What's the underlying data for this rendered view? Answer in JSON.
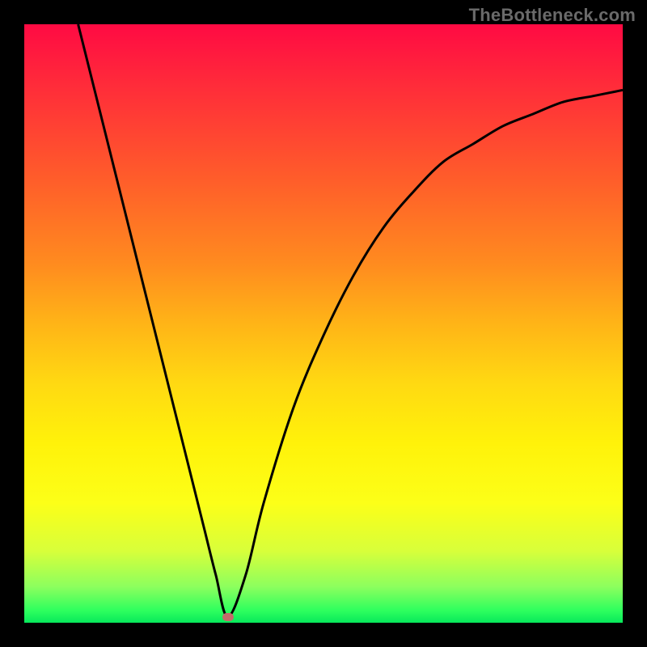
{
  "watermark": "TheBottleneck.com",
  "chart_data": {
    "type": "line",
    "title": "",
    "xlabel": "",
    "ylabel": "",
    "xlim": [
      0,
      100
    ],
    "ylim": [
      0,
      100
    ],
    "grid": false,
    "legend": false,
    "series": [
      {
        "name": "curve",
        "color": "#000000",
        "x": [
          9,
          15,
          20,
          25,
          28,
          30,
          32,
          34,
          37,
          40,
          45,
          50,
          55,
          60,
          65,
          70,
          75,
          80,
          85,
          90,
          95,
          100
        ],
        "y": [
          100,
          76,
          56,
          36,
          24,
          16,
          8,
          1,
          8,
          20,
          36,
          48,
          58,
          66,
          72,
          77,
          80,
          83,
          85,
          87,
          88,
          89
        ]
      }
    ],
    "marker": {
      "x": 34,
      "y": 1,
      "color": "#c56a6a"
    },
    "background_gradient": {
      "direction": "vertical",
      "stops": [
        {
          "pos": 0.0,
          "color": "#ff0a43"
        },
        {
          "pos": 0.5,
          "color": "#ffb417"
        },
        {
          "pos": 0.8,
          "color": "#fcff18"
        },
        {
          "pos": 1.0,
          "color": "#07e85b"
        }
      ]
    }
  }
}
